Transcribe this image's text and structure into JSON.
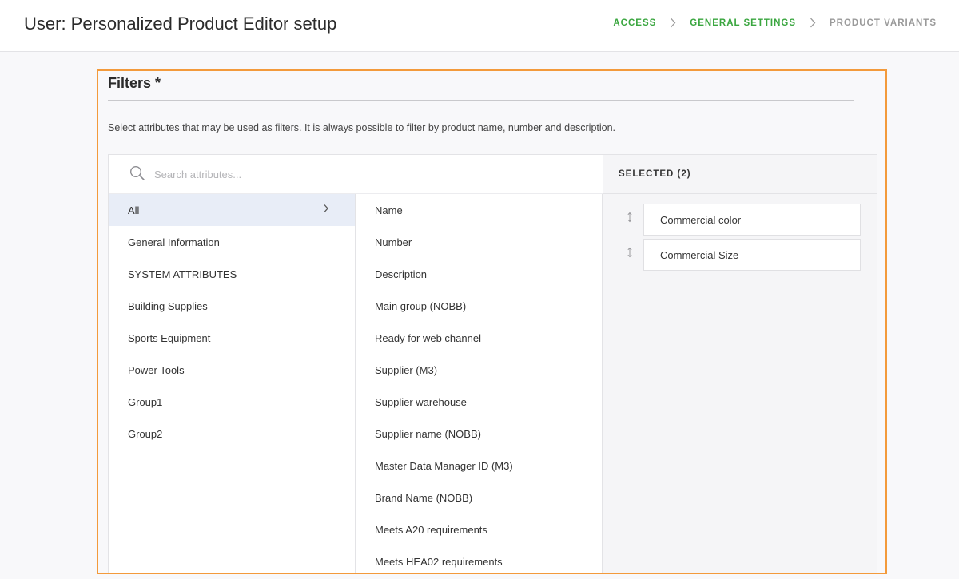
{
  "header": {
    "title": "User: Personalized Product Editor setup",
    "steps": [
      {
        "label": "ACCESS",
        "state": "done"
      },
      {
        "label": "GENERAL SETTINGS",
        "state": "done"
      },
      {
        "label": "PRODUCT VARIANTS",
        "state": "todo"
      }
    ]
  },
  "filters": {
    "title": "Filters *",
    "description": "Select attributes that may be used as filters. It is always possible to filter by product name, number and description.",
    "search": {
      "placeholder": "Search attributes...",
      "value": ""
    },
    "groups": [
      {
        "label": "All",
        "active": true
      },
      {
        "label": "General Information"
      },
      {
        "label": "SYSTEM ATTRIBUTES"
      },
      {
        "label": "Building Supplies"
      },
      {
        "label": "Sports Equipment"
      },
      {
        "label": "Power Tools"
      },
      {
        "label": "Group1"
      },
      {
        "label": "Group2"
      }
    ],
    "attributes": [
      "Name",
      "Number",
      "Description",
      "Main group (NOBB)",
      "Ready for web channel",
      "Supplier (M3)",
      "Supplier warehouse",
      "Supplier name (NOBB)",
      "Master Data Manager ID (M3)",
      "Brand Name (NOBB)",
      "Meets A20 requirements",
      "Meets HEA02 requirements"
    ],
    "selected": {
      "header": "SELECTED (2)",
      "items": [
        "Commercial color",
        "Commercial Size"
      ]
    }
  },
  "colors": {
    "accent_done": "#3aa63f",
    "step_todo": "#9a9a9a",
    "highlight_border": "#f39a3b",
    "active_group_bg": "#e8edf7"
  },
  "icons": {
    "search": "search-icon",
    "chevron": "chevron-right-icon",
    "drag": "drag-handle-icon"
  }
}
